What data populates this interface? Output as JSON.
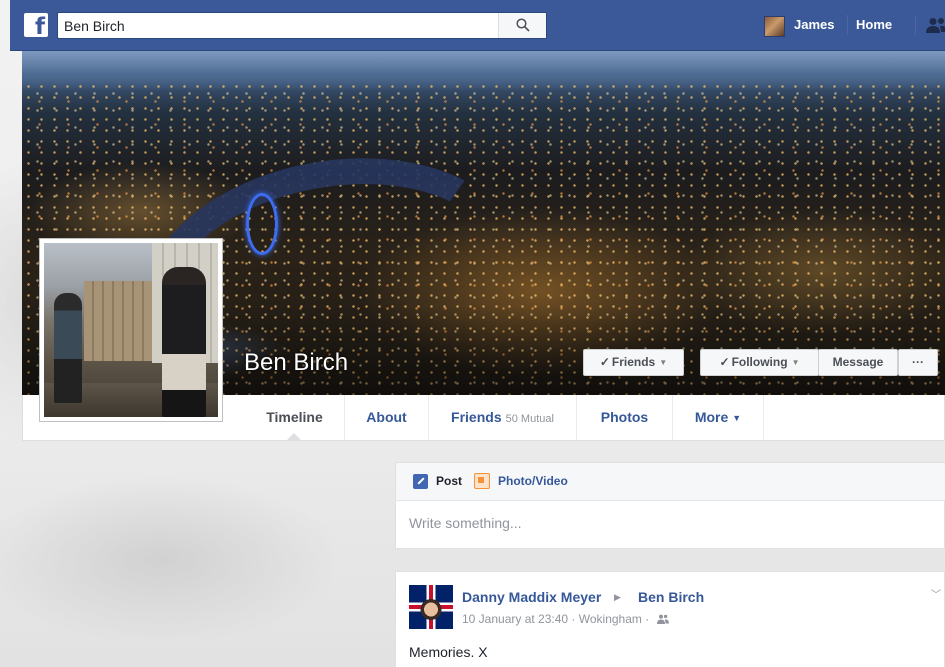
{
  "nav": {
    "search_value": "Ben Birch",
    "user_name": "James",
    "home_label": "Home",
    "brand_color": "#3b5998"
  },
  "profile": {
    "name": "Ben Birch",
    "buttons": {
      "friends": "Friends",
      "following": "Following",
      "message": "Message",
      "more": "···"
    },
    "tabs": {
      "timeline": "Timeline",
      "about": "About",
      "friends": "Friends",
      "friends_mutual": "50 Mutual",
      "photos": "Photos",
      "more": "More"
    }
  },
  "composer": {
    "post_tab": "Post",
    "photo_tab": "Photo/Video",
    "placeholder": "Write something..."
  },
  "post": {
    "author": "Danny Maddix Meyer",
    "target": "Ben Birch",
    "meta": "10 January at 23:40 · Wokingham ·",
    "text": "Memories. X"
  },
  "icons": [
    "facebook-logo-icon",
    "search-icon",
    "friend-requests-icon",
    "check-icon",
    "caret-down-icon",
    "edit-icon",
    "photo-icon",
    "audience-friends-icon",
    "chevron-down-icon"
  ]
}
